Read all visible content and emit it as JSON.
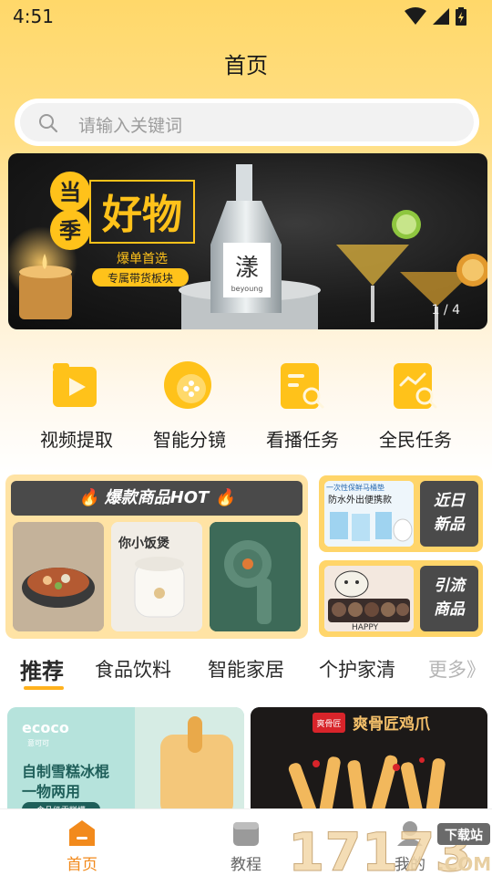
{
  "status_bar": {
    "time": "4:51"
  },
  "header": {
    "title": "首页"
  },
  "search": {
    "placeholder": "请输入关键词"
  },
  "banner": {
    "tag_top": "当",
    "tag_bottom": "季",
    "headline": "好物",
    "sub1": "爆单首选",
    "sub2": "专属带货板块",
    "bottle_brand": "漾",
    "bottle_sub": "beyoung",
    "counter": "1 / 4"
  },
  "quick_actions": [
    {
      "label": "视频提取",
      "icon": "video-icon"
    },
    {
      "label": "智能分镜",
      "icon": "storyboard-icon"
    },
    {
      "label": "看播任务",
      "icon": "watch-task-icon"
    },
    {
      "label": "全民任务",
      "icon": "chart-task-icon"
    }
  ],
  "hot": {
    "title": "爆款商品HOT",
    "product_texts": [
      "你小饭煲"
    ]
  },
  "side_cards": [
    {
      "label_line1": "近日",
      "label_line2": "新品",
      "img_text1": "一次性保鲜马桶垫",
      "img_text2": "防水外出便携款"
    },
    {
      "label_line1": "引流",
      "label_line2": "商品",
      "img_text1": "HAPPY"
    }
  ],
  "category_tabs": [
    {
      "label": "推荐",
      "active": true
    },
    {
      "label": "食品饮料",
      "active": false
    },
    {
      "label": "智能家居",
      "active": false
    },
    {
      "label": "个护家清",
      "active": false
    },
    {
      "label": "更多》",
      "active": false
    }
  ],
  "product_cards": [
    {
      "brand": "ecoco",
      "brand_sub": "意可可",
      "line1": "自制雪糕冰棍",
      "line2": "一物两用",
      "tag": "食品级雪糕模"
    },
    {
      "brand_badge": "爽骨匠",
      "title": "爽骨匠鸡爪"
    }
  ],
  "bottom_nav": [
    {
      "label": "首页",
      "icon": "home-icon",
      "active": true
    },
    {
      "label": "教程",
      "icon": "tutorial-icon",
      "active": false
    },
    {
      "label": "我的",
      "icon": "profile-icon",
      "active": false
    }
  ],
  "watermark": {
    "number": "17173",
    "badge": "下载站",
    "suffix": ".COM"
  },
  "colors": {
    "accent": "#ffb21e",
    "hot_bg": "#ffe3a4",
    "label_bg": "#4a4a4a",
    "active_nav": "#f28a1c"
  }
}
